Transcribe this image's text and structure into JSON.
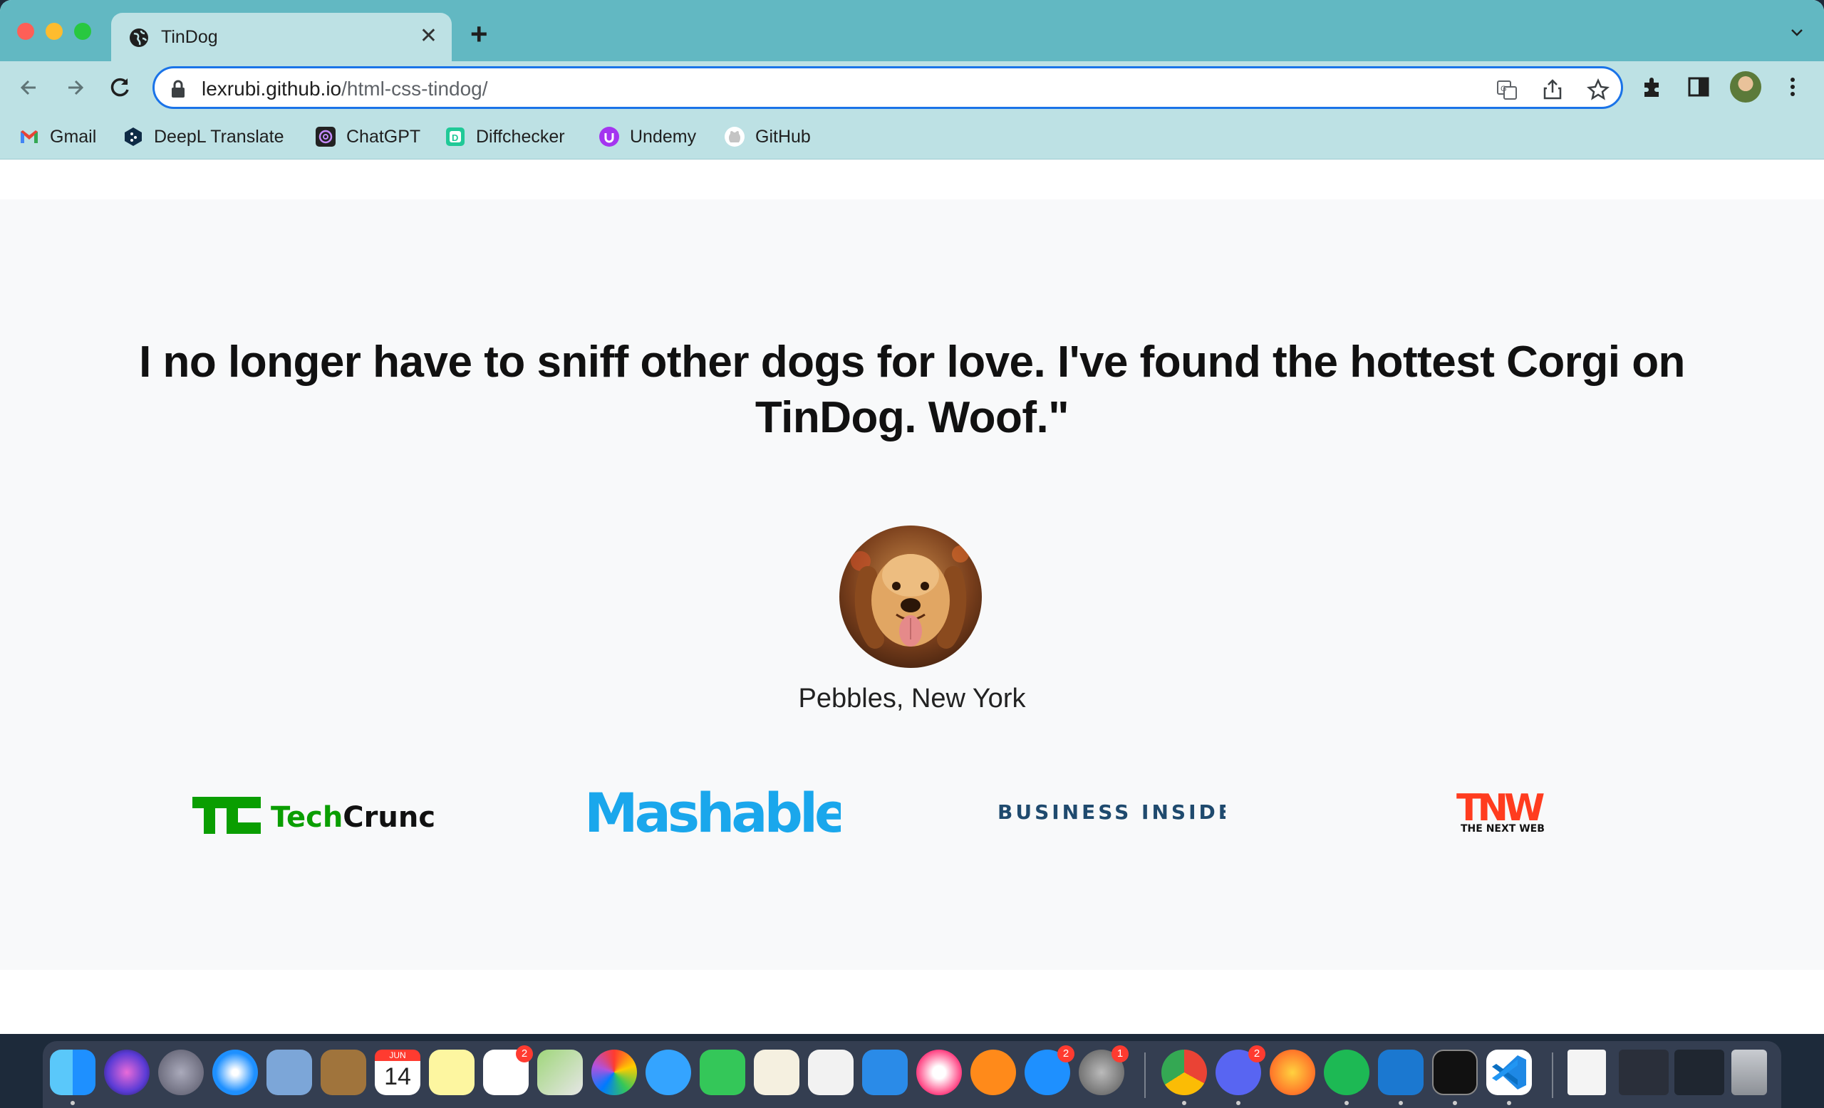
{
  "browser": {
    "tab_title": "TinDog",
    "url_host": "lexrubi.github.io",
    "url_path": "/html-css-tindog/",
    "bookmarks": [
      {
        "label": "Gmail",
        "icon": "gmail-icon"
      },
      {
        "label": "DeepL Translate",
        "icon": "deepl-icon"
      },
      {
        "label": "ChatGPT",
        "icon": "chatgpt-icon"
      },
      {
        "label": "Diffchecker",
        "icon": "diffchecker-icon"
      },
      {
        "label": "Undemy",
        "icon": "udemy-icon"
      },
      {
        "label": "GitHub",
        "icon": "github-icon"
      }
    ]
  },
  "testimonial": {
    "quote": "I no longer have to sniff other dogs for love. I've found the hottest Corgi on TinDog. Woof.\"",
    "author": "Pebbles, New York"
  },
  "press": {
    "techcrunch": "TechCrunch",
    "techcrunch_mark": "TC",
    "mashable": "Mashable",
    "business_insider": "BUSINESS INSIDER",
    "tnw": "TNW",
    "tnw_sub": "THE NEXT WEB"
  },
  "dock": {
    "calendar_month": "JUN",
    "calendar_day": "14",
    "badges": {
      "reminders": "2",
      "appstore": "2",
      "settings": "1",
      "discord": "2"
    }
  },
  "colors": {
    "tabstrip": "#62b8c2",
    "toolbar": "#bde1e4",
    "focus": "#1a73e8",
    "techcrunch_green": "#0a9e01",
    "mashable_blue": "#1aa7ec",
    "bi_navy": "#1f4a6e",
    "tnw_red": "#ff3c1f"
  }
}
